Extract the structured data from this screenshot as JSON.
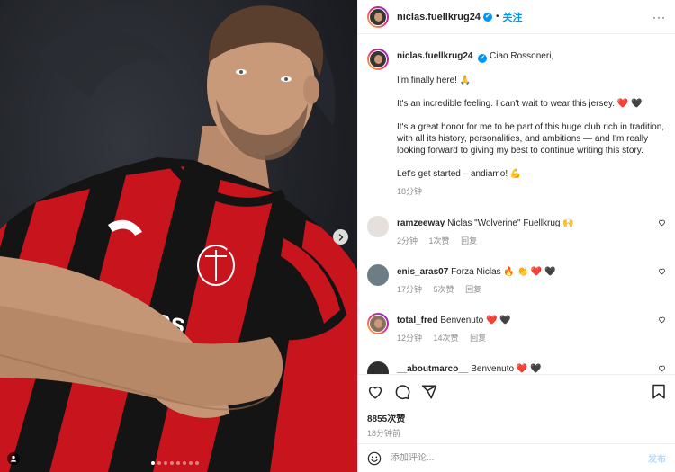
{
  "post": {
    "username": "niclas.fuellkrug24",
    "verified_mark": "✔",
    "separator": "•",
    "follow_label": "关注",
    "more_label": "···"
  },
  "caption": {
    "username": "niclas.fuellkrug24",
    "greeting": "Ciao Rossoneri,",
    "paragraphs": [
      "I'm finally here! 🙏",
      "It's an incredible feeling. I can't wait to wear this jersey. ❤️ 🖤",
      "It's a great honor for me to be part of this huge club rich in tradition, with all its history, personalities, and ambitions — and I'm really looking forward to giving my best to continue writing this story.",
      "Let's get started – andiamo! 💪"
    ],
    "time": "18分钟"
  },
  "comments": [
    {
      "user": "ramzeeway",
      "text": "Niclas \"Wolverine\" Fuellkrug 🙌",
      "time": "2分钟",
      "likes": "1次赞",
      "reply": "回复"
    },
    {
      "user": "enis_aras07",
      "text": "Forza Niclas 🔥 👏 ❤️ 🖤",
      "time": "17分钟",
      "likes": "5次赞",
      "reply": "回复"
    },
    {
      "user": "total_fred",
      "text": "Benvenuto ❤️ 🖤",
      "time": "12分钟",
      "likes": "14次赞",
      "reply": "回复"
    },
    {
      "user": "__aboutmarco__",
      "text": "Benvenuto ❤️ 🖤",
      "time": "",
      "likes": "",
      "reply": ""
    }
  ],
  "footer": {
    "likes": "8855次赞",
    "time": "18分钟前",
    "comment_placeholder": "添加评论...",
    "post_label": "发布"
  },
  "media": {
    "carousel_count": 8,
    "active_index": 0,
    "icons": [
      "chevron-right-icon",
      "user-tag-icon",
      "heart-icon",
      "comment-icon",
      "share-icon",
      "bookmark-icon",
      "emoji-icon"
    ]
  }
}
